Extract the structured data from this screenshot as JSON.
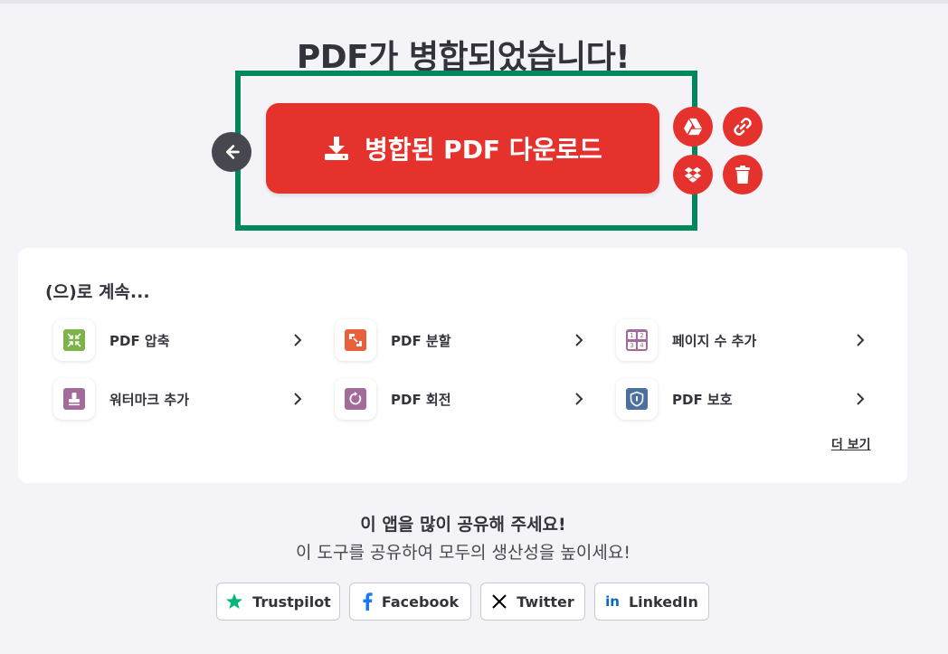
{
  "page": {
    "title": "PDF가 병합되었습니다!"
  },
  "actions": {
    "download_label": "병합된 PDF 다운로드",
    "accent_color": "#e5322d",
    "highlight_color": "#00875a"
  },
  "continue": {
    "title": "(으)로 계속...",
    "tools": [
      {
        "label": "PDF 압축",
        "icon": "compress-icon",
        "color": "#7db34b"
      },
      {
        "label": "PDF 분할",
        "icon": "split-icon",
        "color": "#e8613c"
      },
      {
        "label": "페이지 수 추가",
        "icon": "page-numbers-icon",
        "color": "#a36b99"
      },
      {
        "label": "워터마크 추가",
        "icon": "watermark-icon",
        "color": "#a36b99"
      },
      {
        "label": "PDF 회전",
        "icon": "rotate-icon",
        "color": "#a36b99"
      },
      {
        "label": "PDF 보호",
        "icon": "shield-icon",
        "color": "#4b6f9e"
      }
    ],
    "page_numbers": [
      "1",
      "2",
      "3",
      "4"
    ],
    "more_label": "더 보기"
  },
  "share": {
    "title": "이 앱을 많이 공유해 주세요!",
    "subtitle": "이 도구를 공유하여 모두의 생산성을 높이세요!",
    "buttons": [
      {
        "label": "Trustpilot",
        "icon": "star-icon",
        "color": "#00b67a"
      },
      {
        "label": "Facebook",
        "icon": "facebook-icon",
        "color": "#1877f2"
      },
      {
        "label": "Twitter",
        "icon": "x-icon",
        "color": "#000000"
      },
      {
        "label": "LinkedIn",
        "icon": "linkedin-icon",
        "color": "#0a66c2"
      }
    ]
  }
}
